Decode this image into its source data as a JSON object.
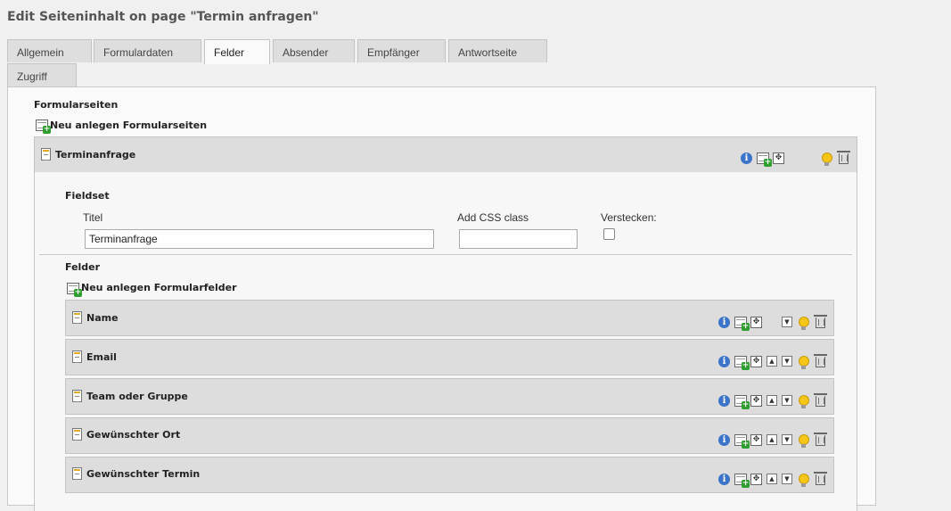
{
  "page": {
    "title": "Edit Seiteninhalt on page \"Termin anfragen\""
  },
  "tabs": [
    {
      "label": "Allgemein",
      "active": false
    },
    {
      "label": "Formulardaten",
      "active": false
    },
    {
      "label": "Felder",
      "active": true
    },
    {
      "label": "Absender",
      "active": false
    },
    {
      "label": "Empfänger",
      "active": false
    },
    {
      "label": "Antwortseite",
      "active": false
    },
    {
      "label": "Zugriff",
      "active": false
    }
  ],
  "formpages": {
    "heading": "Formularseiten",
    "new_label": "Neu anlegen Formularseiten",
    "item_title": "Terminanfrage"
  },
  "fieldset": {
    "heading": "Fieldset",
    "title_label": "Titel",
    "title_value": "Terminanfrage",
    "css_label": "Add CSS class",
    "css_value": "",
    "hide_label": "Verstecken:"
  },
  "fields": {
    "heading": "Felder",
    "new_label": "Neu anlegen Formularfelder",
    "items": [
      "Name",
      "Email",
      "Team oder Gruppe",
      "Gewünschter Ort",
      "Gewünschter Termin"
    ]
  },
  "icons": {
    "info": "i",
    "move": "✥",
    "up": "▲",
    "down": "▼"
  }
}
